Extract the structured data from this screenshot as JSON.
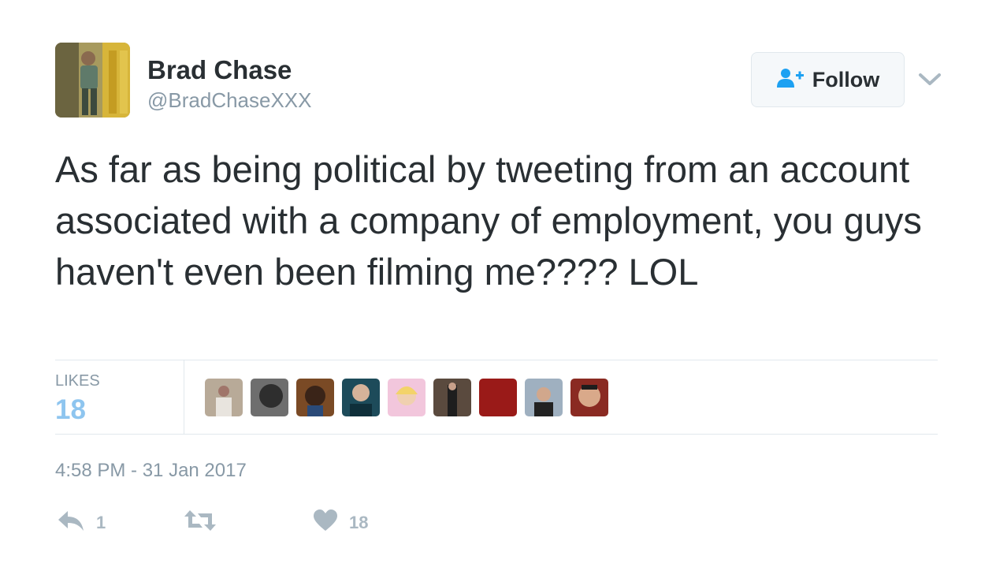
{
  "author": {
    "name": "Brad Chase",
    "handle": "@BradChaseXXX"
  },
  "follow_button": {
    "label": "Follow",
    "icon": "add-user-icon"
  },
  "menu_icon": "chevron-down-icon",
  "tweet": {
    "text": "As far as being political by tweeting from an account associated with a company of employment, you guys haven't even been filming me???? LOL",
    "timestamp": "4:58 PM - 31 Jan 2017"
  },
  "stats": {
    "likes_label": "LIKES",
    "likes_count": "18"
  },
  "likers_count": 9,
  "actions": {
    "reply_count": "1",
    "retweet_count": "",
    "like_count": "18"
  },
  "colors": {
    "accent": "#1da1f2",
    "likes_count": "#8ec5ef",
    "muted": "#8899a6",
    "action_icons": "#aab8c2"
  }
}
